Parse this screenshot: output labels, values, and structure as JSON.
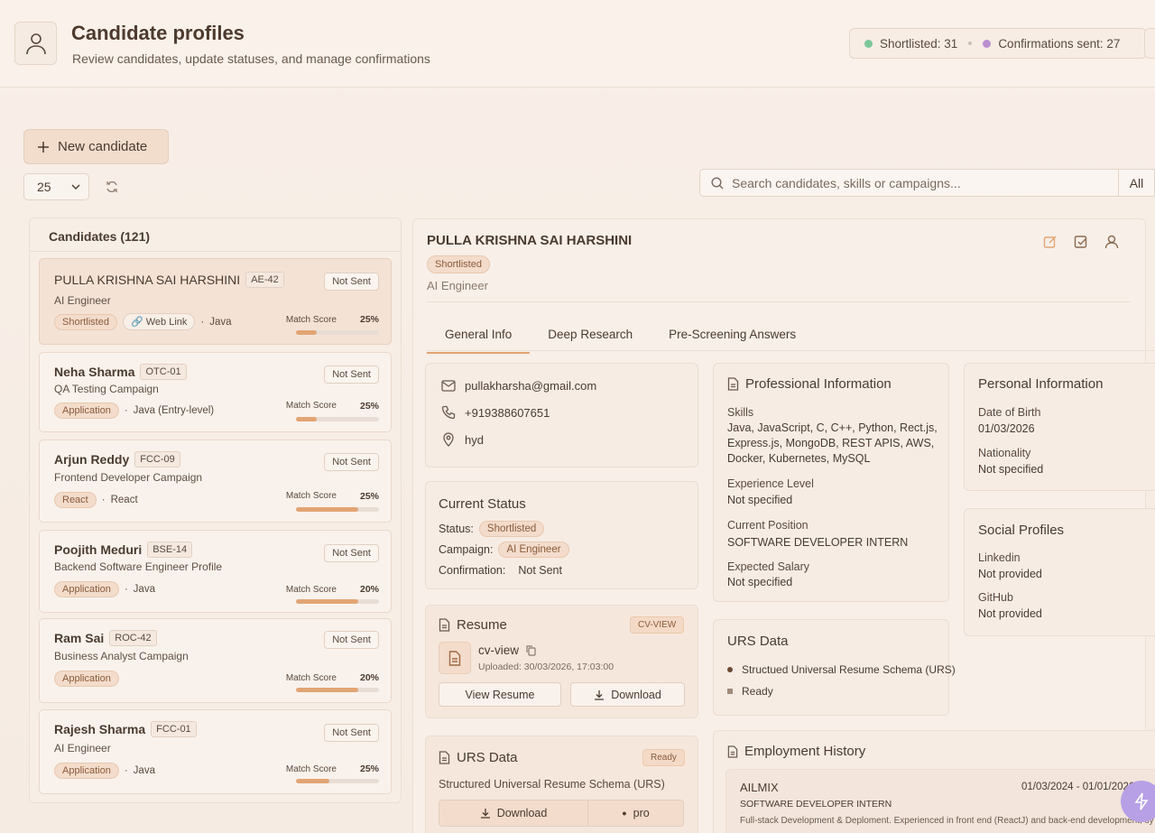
{
  "header": {
    "title": "Candidate profiles",
    "subtitle": "Review candidates, update statuses, and manage confirmations",
    "stats": [
      {
        "label": "Shortlisted: 31",
        "color": "#7cc79a"
      },
      {
        "label": "Confirmations sent: 27",
        "color": "#b98fd1"
      }
    ]
  },
  "toolbar": {
    "new_candidate": "New candidate",
    "page_size": "25",
    "search_placeholder": "Search candidates, skills or campaigns...",
    "filter": "All"
  },
  "candidates": {
    "heading": "Candidates (121)",
    "items": [
      {
        "name": "PULLA KRISHNA SAI HARSHINI",
        "code": "AE-42",
        "role": "AI Engineer",
        "status": "Not Sent",
        "tag": "Shortlisted",
        "link": "Web Link",
        "skill": "Java",
        "match_label": "Match Score",
        "match": "25%",
        "match_value": 0.25
      },
      {
        "name": "Neha Sharma",
        "code": "OTC-01",
        "role": "QA Testing Campaign",
        "status": "Not Sent",
        "tag": "Application",
        "skill": "Java (Entry-level)",
        "match_label": "Match Score",
        "match": "25%",
        "match_value": 0.25
      },
      {
        "name": "Arjun Reddy",
        "code": "FCC-09",
        "role": "Frontend Developer Campaign",
        "status": "Not Sent",
        "tag": "React",
        "skill": "React",
        "match_label": "Match Score",
        "match": "25%",
        "match_value": 0.75
      },
      {
        "name": "Poojith Meduri",
        "code": "BSE-14",
        "role": "Backend Software Engineer Profile",
        "status": "Not Sent",
        "tag": "Application",
        "skill": "Java",
        "match_label": "Match Score",
        "match": "20%",
        "match_value": 0.75
      },
      {
        "name": "Ram Sai",
        "code": "ROC-42",
        "role": "Business Analyst Campaign",
        "status": "Not Sent",
        "tag": "Application",
        "skill": "",
        "match_label": "Match Score",
        "match": "20%",
        "match_value": 0.75
      },
      {
        "name": "Rajesh Sharma",
        "code": "FCC-01",
        "role": "AI Engineer",
        "status": "Not Sent",
        "tag": "Application",
        "skill": "Java",
        "match_label": "Match Score",
        "match": "25%",
        "match_value": 0.4
      }
    ]
  },
  "detail": {
    "name": "PULLA KRISHNA SAI HARSHINI",
    "status": "Shortlisted",
    "role": "AI Engineer",
    "tabs": [
      "General Info",
      "Deep Research",
      "Pre-Screening Answers"
    ],
    "contact": {
      "email": "pullakharsha@gmail.com",
      "phone": "+919388607651",
      "location": "hyd"
    },
    "current_status": {
      "title": "Current Status",
      "status_label": "Status:",
      "status": "Shortlisted",
      "campaign_label": "Campaign:",
      "campaign": "AI Engineer",
      "confirmation_label": "Confirmation:",
      "confirmation": "Not Sent"
    },
    "resume": {
      "title": "Resume",
      "badge": "CV-VIEW",
      "file": "cv-view",
      "uploaded": "Uploaded: 30/03/2026, 17:03:00",
      "view": "View Resume",
      "download": "Download"
    },
    "urs_left": {
      "title": "URS Data",
      "badge": "Ready",
      "desc": "Structured Universal Resume Schema (URS)",
      "download": "Download",
      "pro": "pro"
    },
    "professional": {
      "title": "Professional Information",
      "skills_label": "Skills",
      "skills": [
        "Java, JavaScript, C, C++, Python, Rect.js,",
        "Express.js, MongoDB, REST APIS, AWS,",
        "Docker, Kubernetes, MySQL"
      ],
      "experience_label": "Experience Level",
      "experience": "Not specified",
      "position_label": "Current Position",
      "position": "SOFTWARE DEVELOPER INTERN",
      "salary_label": "Expected Salary",
      "salary": "Not specified"
    },
    "personal": {
      "title": "Personal Information",
      "dob_label": "Date of Birth",
      "dob": "01/03/2026",
      "nationality_label": "Nationality",
      "nationality": "Not specified"
    },
    "social": {
      "title": "Social Profiles",
      "linkedin_label": "Linkedin",
      "linkedin": "Not provided",
      "github_label": "GitHub",
      "github": "Not provided"
    },
    "urs_mid": {
      "title": "URS Data",
      "items": [
        "Structued Universal Resume Schema (URS)",
        "Ready"
      ]
    },
    "employment": {
      "title": "Employment History",
      "company": "AILMIX",
      "dates": "01/03/2024 - 01/01/2026",
      "position": "SOFTWARE DEVELOPER INTERN",
      "desc": "Full-stack Development & Deploment. Experienced in front end (ReactJ) and back-end development, sy"
    }
  }
}
